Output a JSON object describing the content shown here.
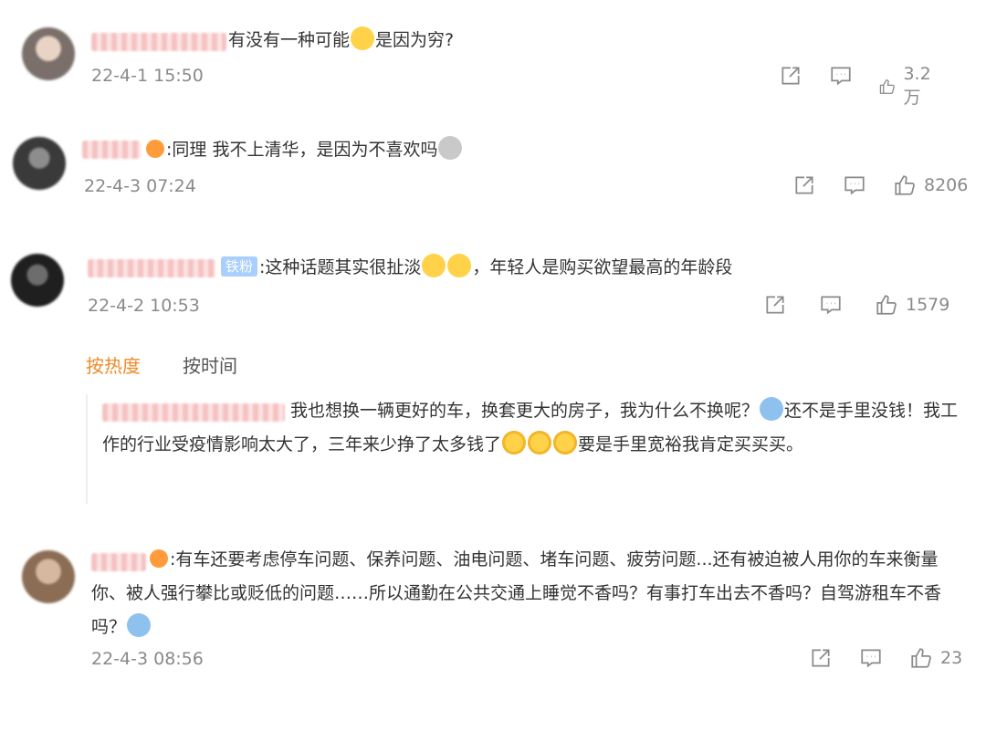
{
  "colors": {
    "accent": "#f08a2a",
    "meta": "#8a8a8a",
    "text": "#333333",
    "badge": "#a9cfff"
  },
  "comments": [
    {
      "text_before": "有没有一种可能",
      "text_after": "是因为穷?",
      "time": "22-4-1 15:50",
      "likes": "3.2万"
    },
    {
      "text_before": ":同理 我不上清华，是因为不喜欢吗",
      "time": "22-4-3 07:24",
      "likes": "8206"
    },
    {
      "badge": "铁粉",
      "text_before": ":这种话题其实很扯淡",
      "text_after": "，年轻人是购买欲望最高的年龄段",
      "time": "22-4-2 10:53",
      "likes": "1579"
    }
  ],
  "sort_tabs": {
    "hot": "按热度",
    "time": "按时间"
  },
  "reply": {
    "part1": "我也想换一辆更好的车，换套更大的房子，我为什么不换呢？",
    "part2": "还不是手里没钱！我工作的行业受疫情影响太大了，三年来少挣了太多钱了",
    "part3": "要是手里宽裕我肯定买买买。"
  },
  "comment4": {
    "text_before": ":有车还要考虑停车问题、保养问题、油电问题、堵车问题、疲劳问题...还有被迫被人用你的车来衡量你、被人强行攀比或贬低的问题……所以通勤在公共交通上睡觉不香吗？有事打车出去不香吗？自驾游租车不香吗？",
    "time": "22-4-3 08:56",
    "likes": "23"
  },
  "icons": [
    "share-icon",
    "comment-icon",
    "like-icon",
    "emoji-icon",
    "medal-icon"
  ]
}
